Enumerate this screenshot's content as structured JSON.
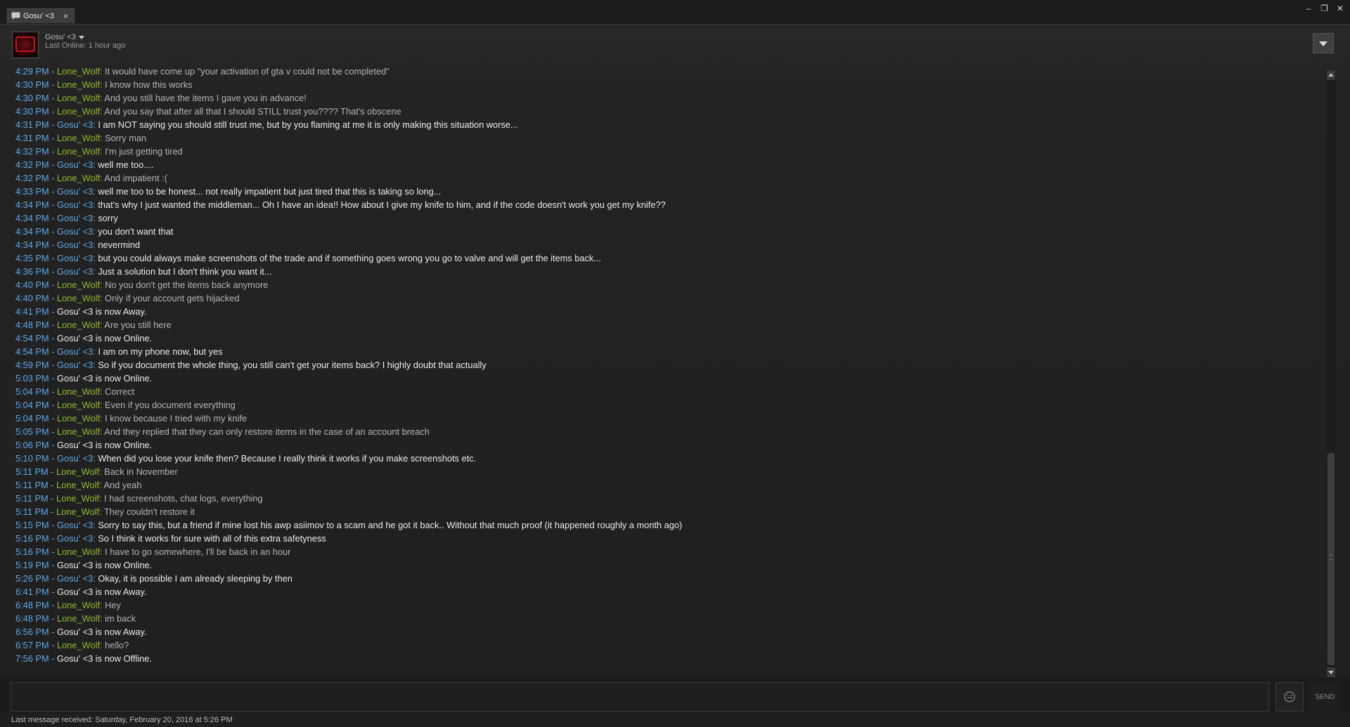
{
  "window": {
    "tab_title": "Gosu' <3",
    "tab_close": "×",
    "minimize": "–",
    "restore": "❐",
    "close": "✕"
  },
  "friend": {
    "name": "Gosu' <3",
    "status": "Last Online: 1 hour ago"
  },
  "messages": [
    {
      "time": "4:29 PM",
      "sender": "Lone_Wolf",
      "text": "It would have come up \"your activation of gta v could not be completed\""
    },
    {
      "time": "4:30 PM",
      "sender": "Lone_Wolf",
      "text": "I know how this works"
    },
    {
      "time": "4:30 PM",
      "sender": "Lone_Wolf",
      "text": "And you still have the items I gave you in advance!"
    },
    {
      "time": "4:30 PM",
      "sender": "Lone_Wolf",
      "text": "And you say that after all that I should STILL trust you???? That's obscene"
    },
    {
      "time": "4:31 PM",
      "sender": "Gosu' <3",
      "text": "I am NOT saying you should still trust me, but by you flaming at me it is only making this situation worse..."
    },
    {
      "time": "4:31 PM",
      "sender": "Lone_Wolf",
      "text": "Sorry man"
    },
    {
      "time": "4:32 PM",
      "sender": "Lone_Wolf",
      "text": "I'm just getting tired"
    },
    {
      "time": "4:32 PM",
      "sender": "Gosu' <3",
      "text": "well me too...."
    },
    {
      "time": "4:32 PM",
      "sender": "Lone_Wolf",
      "text": "And impatient :("
    },
    {
      "time": "4:33 PM",
      "sender": "Gosu' <3",
      "text": "well me too to be honest... not really impatient but just tired that this is taking so long..."
    },
    {
      "time": "4:34 PM",
      "sender": "Gosu' <3",
      "text": "that's why I just wanted the middleman... Oh I have an idea!! How about I give my knife to him, and if the code doesn't work you get my knife??"
    },
    {
      "time": "4:34 PM",
      "sender": "Gosu' <3",
      "text": "sorry"
    },
    {
      "time": "4:34 PM",
      "sender": "Gosu' <3",
      "text": "you don't want that"
    },
    {
      "time": "4:34 PM",
      "sender": "Gosu' <3",
      "text": "nevermind"
    },
    {
      "time": "4:35 PM",
      "sender": "Gosu' <3",
      "text": "but you could always make screenshots of the trade and if something goes wrong you go to valve and will get the items back..."
    },
    {
      "time": "4:36 PM",
      "sender": "Gosu' <3",
      "text": "Just a solution but I don't think you want it..."
    },
    {
      "time": "4:40 PM",
      "sender": "Lone_Wolf",
      "text": "No you don't get the items back anymore"
    },
    {
      "time": "4:40 PM",
      "sender": "Lone_Wolf",
      "text": "Only if your account gets hijacked"
    },
    {
      "time": "4:41 PM",
      "system": "Gosu' <3 is now Away."
    },
    {
      "time": "4:48 PM",
      "sender": "Lone_Wolf",
      "text": "Are you still here"
    },
    {
      "time": "4:54 PM",
      "system": "Gosu' <3 is now Online."
    },
    {
      "time": "4:54 PM",
      "sender": "Gosu' <3",
      "text": "I am on my phone now, but yes"
    },
    {
      "time": "4:59 PM",
      "sender": "Gosu' <3",
      "text": "So if you document the whole thing, you still can't get your items back? I highly doubt that actually"
    },
    {
      "time": "5:03 PM",
      "system": "Gosu' <3 is now Online."
    },
    {
      "time": "5:04 PM",
      "sender": "Lone_Wolf",
      "text": "Correct"
    },
    {
      "time": "5:04 PM",
      "sender": "Lone_Wolf",
      "text": "Even if you document everything"
    },
    {
      "time": "5:04 PM",
      "sender": "Lone_Wolf",
      "text": "I know because I tried with my knife"
    },
    {
      "time": "5:05 PM",
      "sender": "Lone_Wolf",
      "text": "And they replied that they can only restore items in the case of an account breach"
    },
    {
      "time": "5:06 PM",
      "system": "Gosu' <3 is now Online."
    },
    {
      "time": "5:10 PM",
      "sender": "Gosu' <3",
      "text": "When did you lose your knife then? Because I really think it works if you make screenshots etc."
    },
    {
      "time": "5:11 PM",
      "sender": "Lone_Wolf",
      "text": "Back in November"
    },
    {
      "time": "5:11 PM",
      "sender": "Lone_Wolf",
      "text": "And yeah"
    },
    {
      "time": "5:11 PM",
      "sender": "Lone_Wolf",
      "text": "I had screenshots, chat logs, everything"
    },
    {
      "time": "5:11 PM",
      "sender": "Lone_Wolf",
      "text": "They couldn't restore it"
    },
    {
      "time": "5:15 PM",
      "sender": "Gosu' <3",
      "text": "Sorry to say this, but a friend if mine lost his awp asiimov to a scam and he got it back.. Without that much proof (it happened roughly a month ago)"
    },
    {
      "time": "5:16 PM",
      "sender": "Gosu' <3",
      "text": "So I think it works for sure with all of this extra safetyness"
    },
    {
      "time": "5:16 PM",
      "sender": "Lone_Wolf",
      "text": "I have to go somewhere, I'll be back in an hour"
    },
    {
      "time": "5:19 PM",
      "system": "Gosu' <3 is now Online."
    },
    {
      "time": "5:26 PM",
      "sender": "Gosu' <3",
      "text": "Okay, it is possible I am already sleeping by then"
    },
    {
      "time": "6:41 PM",
      "system": "Gosu' <3 is now Away."
    },
    {
      "time": "6:48 PM",
      "sender": "Lone_Wolf",
      "text": "Hey"
    },
    {
      "time": "6:48 PM",
      "sender": "Lone_Wolf",
      "text": "im back"
    },
    {
      "time": "6:56 PM",
      "system": "Gosu' <3 is now Away."
    },
    {
      "time": "6:57 PM",
      "sender": "Lone_Wolf",
      "text": "hello?"
    },
    {
      "time": "7:56 PM",
      "system": "Gosu' <3 is now Offline."
    }
  ],
  "composer": {
    "input_value": "",
    "emote_icon": "smiley-face-icon",
    "send_label": "SEND"
  },
  "footer": {
    "last_message": "Last message received: Saturday, February 20, 2016 at 5:26 PM"
  },
  "colors": {
    "timestamp": "#62a7e3",
    "friend_name": "#62a7e3",
    "self_name": "#8fbc35",
    "background": "#1f1f1f"
  }
}
